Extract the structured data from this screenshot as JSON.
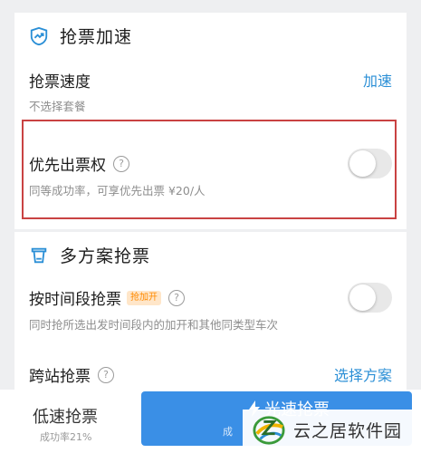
{
  "section_speed": {
    "title": "抢票加速",
    "speed_row": {
      "title": "抢票速度",
      "subtitle": "不选择套餐",
      "link": "加速"
    },
    "priority_row": {
      "title": "优先出票权",
      "help": "?",
      "subtitle": "同等成功率，可享优先出票 ¥20/人",
      "toggle_on": false
    }
  },
  "section_multi": {
    "title": "多方案抢票",
    "time_row": {
      "title": "按时间段抢票",
      "tag": "抢加开",
      "help": "?",
      "subtitle": "同时抢所选出发时间段内的加开和其他同类型车次",
      "toggle_on": false
    },
    "station_row": {
      "title": "跨站抢票",
      "help": "?",
      "link": "选择方案"
    }
  },
  "bottom": {
    "slow_title": "低速抢票",
    "slow_sub": "成功率21%",
    "fast_title": "光速抢票",
    "fast_sub": "成"
  },
  "watermark": {
    "text": "云之居软件园"
  },
  "colors": {
    "accent": "#2b8fd6",
    "button": "#3a8fe6",
    "highlight": "#c94242",
    "tag_bg": "#ffe6c9",
    "tag_fg": "#ff8a00"
  }
}
